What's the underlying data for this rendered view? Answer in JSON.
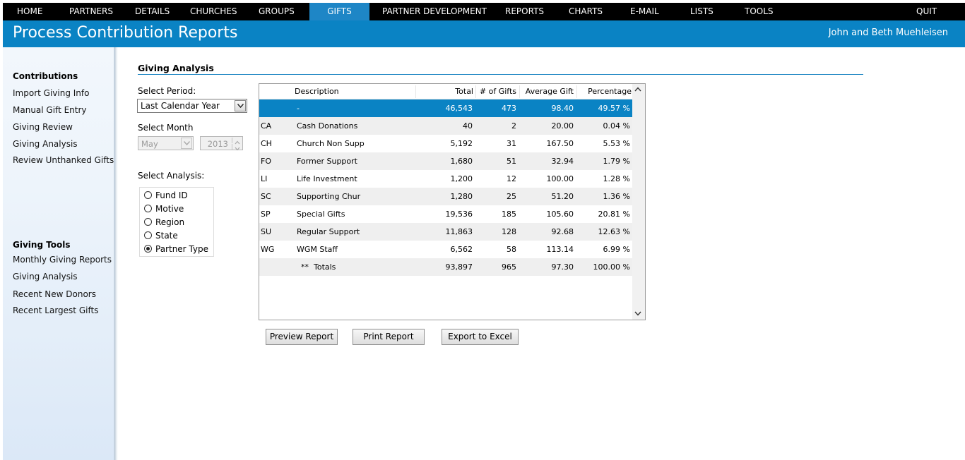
{
  "nav": {
    "items": [
      {
        "label": "HOME"
      },
      {
        "label": "PARTNERS"
      },
      {
        "label": "DETAILS"
      },
      {
        "label": "CHURCHES"
      },
      {
        "label": "GROUPS"
      },
      {
        "label": "GIFTS"
      },
      {
        "label": "PARTNER DEVELOPMENT"
      },
      {
        "label": "REPORTS"
      },
      {
        "label": "CHARTS"
      },
      {
        "label": "E-MAIL"
      },
      {
        "label": "LISTS"
      },
      {
        "label": "TOOLS"
      }
    ],
    "active": "GIFTS",
    "quit_label": "QUIT"
  },
  "header": {
    "title": "Process Contribution Reports",
    "user": "John and Beth Muehleisen"
  },
  "sidebar": {
    "contributions_heading": "Contributions",
    "contributions_items": [
      {
        "label": "Import Giving Info"
      },
      {
        "label": "Manual Gift Entry"
      },
      {
        "label": "Giving Review"
      },
      {
        "label": "Giving Analysis"
      },
      {
        "label": "Review Unthanked Gifts"
      }
    ],
    "tools_heading": "Giving Tools",
    "tools_items": [
      {
        "label": "Monthly Giving Reports"
      },
      {
        "label": "Giving Analysis"
      },
      {
        "label": "Recent New Donors"
      },
      {
        "label": "Recent Largest Gifts"
      }
    ]
  },
  "main": {
    "section_title": "Giving Analysis",
    "period_label": "Select Period:",
    "period_value": "Last Calendar Year",
    "month_label": "Select Month",
    "month_value": "May",
    "year_value": "2013",
    "analysis_label": "Select Analysis:",
    "analysis_options": [
      {
        "label": "Fund ID",
        "selected": false
      },
      {
        "label": "Motive",
        "selected": false
      },
      {
        "label": "Region",
        "selected": false
      },
      {
        "label": "State",
        "selected": false
      },
      {
        "label": "Partner Type",
        "selected": true
      }
    ]
  },
  "grid": {
    "headers": {
      "description": "Description",
      "total": "Total",
      "gifts": "# of Gifts",
      "average": "Average Gift",
      "percentage": "Percentage"
    },
    "rows": [
      {
        "code": "",
        "description": "-",
        "total": "46,543",
        "gifts": "473",
        "average": "98.40",
        "percentage": "49.57 %",
        "selected": true
      },
      {
        "code": "CA",
        "description": "Cash Donations",
        "total": "40",
        "gifts": "2",
        "average": "20.00",
        "percentage": "0.04 %"
      },
      {
        "code": "CH",
        "description": "Church Non Supp",
        "total": "5,192",
        "gifts": "31",
        "average": "167.50",
        "percentage": "5.53 %"
      },
      {
        "code": "FO",
        "description": "Former Support",
        "total": "1,680",
        "gifts": "51",
        "average": "32.94",
        "percentage": "1.79 %"
      },
      {
        "code": "LI",
        "description": "Life Investment",
        "total": "1,200",
        "gifts": "12",
        "average": "100.00",
        "percentage": "1.28 %"
      },
      {
        "code": "SC",
        "description": "Supporting Chur",
        "total": "1,280",
        "gifts": "25",
        "average": "51.20",
        "percentage": "1.36 %"
      },
      {
        "code": "SP",
        "description": "Special Gifts",
        "total": "19,536",
        "gifts": "185",
        "average": "105.60",
        "percentage": "20.81 %"
      },
      {
        "code": "SU",
        "description": "Regular Support",
        "total": "11,863",
        "gifts": "128",
        "average": "92.68",
        "percentage": "12.63 %"
      },
      {
        "code": "WG",
        "description": "WGM Staff",
        "total": "6,562",
        "gifts": "58",
        "average": "113.14",
        "percentage": "6.99 %"
      }
    ],
    "totals": {
      "label": "**  Totals",
      "total": "93,897",
      "gifts": "965",
      "average": "97.30",
      "percentage": "100.00 %"
    }
  },
  "buttons": {
    "preview": "Preview Report",
    "print": "Print Report",
    "export": "Export to Excel"
  }
}
